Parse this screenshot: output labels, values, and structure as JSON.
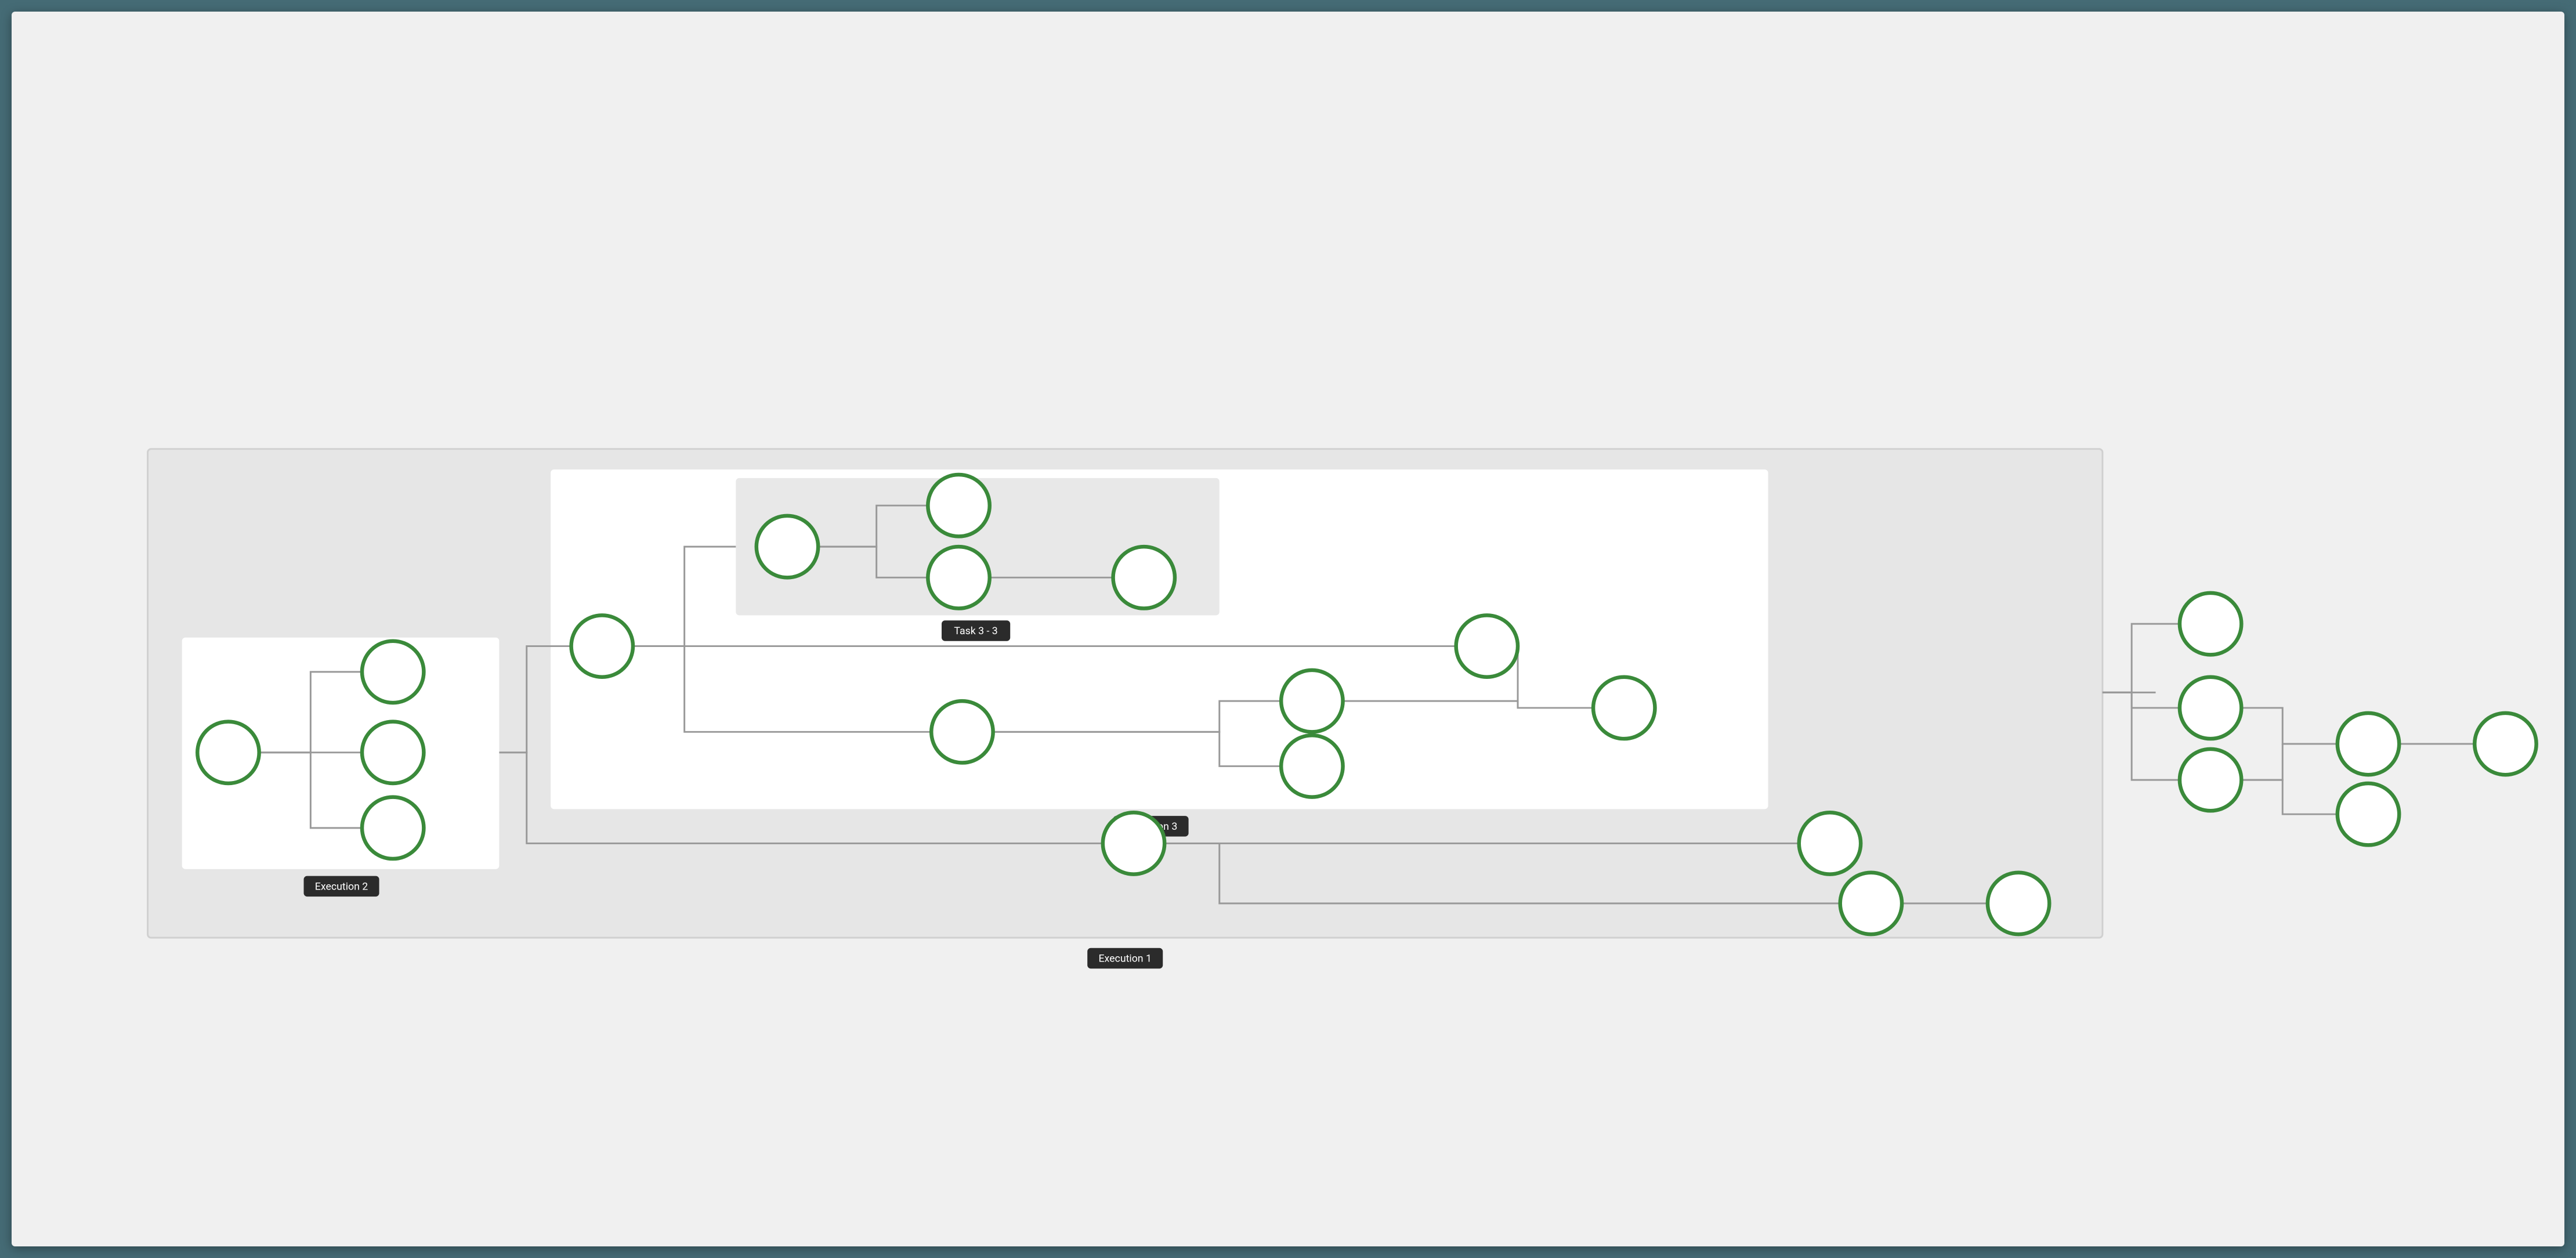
{
  "colors": {
    "page_bg": "#456b75",
    "stage_bg": "#f0f0f0",
    "group_bg": "#e6e6e6",
    "panel_white": "#ffffff",
    "panel_grey": "#e8e8e8",
    "edge": "#999999",
    "node_fill": "#ffffff",
    "node_stroke": "#3a8a3a",
    "label_bg": "#2b2b2b",
    "label_fg": "#ffffff"
  },
  "labels": {
    "execution1": "Execution 1",
    "execution2": "Execution 2",
    "execution3": "Execution 3",
    "task33": "Task 3 - 3"
  },
  "chart_data": {
    "type": "diagram",
    "description": "Nested execution/task workflow tree",
    "groups": [
      {
        "id": "execution1",
        "label_key": "execution1",
        "children_groups": [
          "execution2",
          "execution3"
        ]
      },
      {
        "id": "execution2",
        "label_key": "execution2",
        "parent": "execution1"
      },
      {
        "id": "execution3",
        "label_key": "execution3",
        "parent": "execution1",
        "children_groups": [
          "task33"
        ]
      },
      {
        "id": "task33",
        "label_key": "task33",
        "parent": "execution3"
      }
    ],
    "nodes": [
      {
        "id": "e2_root",
        "group": "execution2"
      },
      {
        "id": "e2_a",
        "group": "execution2"
      },
      {
        "id": "e2_b",
        "group": "execution2"
      },
      {
        "id": "e2_c",
        "group": "execution2"
      },
      {
        "id": "e3_root",
        "group": "execution3"
      },
      {
        "id": "t33_root",
        "group": "task33"
      },
      {
        "id": "t33_a",
        "group": "task33"
      },
      {
        "id": "t33_b",
        "group": "task33"
      },
      {
        "id": "t33_c",
        "group": "task33"
      },
      {
        "id": "e3_mid",
        "group": "execution3"
      },
      {
        "id": "e3_p1",
        "group": "execution3"
      },
      {
        "id": "e3_p2",
        "group": "execution3"
      },
      {
        "id": "e3_q",
        "group": "execution3"
      },
      {
        "id": "e3_out",
        "group": "execution3"
      },
      {
        "id": "e1_low_root",
        "group": "execution1"
      },
      {
        "id": "e1_low_a",
        "group": "execution1"
      },
      {
        "id": "e1_low_b",
        "group": "execution1"
      },
      {
        "id": "e1_low_c",
        "group": "execution1"
      },
      {
        "id": "out_root",
        "group": null
      },
      {
        "id": "out_a",
        "group": null
      },
      {
        "id": "out_b",
        "group": null
      },
      {
        "id": "out_c",
        "group": null
      },
      {
        "id": "out_d",
        "group": null
      },
      {
        "id": "out_e",
        "group": null
      }
    ],
    "edges": [
      [
        "e2_root",
        "e2_a"
      ],
      [
        "e2_root",
        "e2_b"
      ],
      [
        "e2_root",
        "e2_c"
      ],
      [
        "execution2_group",
        "e3_root"
      ],
      [
        "e3_root",
        "task33_group"
      ],
      [
        "e3_root",
        "e3_mid"
      ],
      [
        "e3_root",
        "e3_q"
      ],
      [
        "t33_root",
        "t33_a"
      ],
      [
        "t33_root",
        "t33_b"
      ],
      [
        "t33_b",
        "t33_c"
      ],
      [
        "e3_mid",
        "e3_p1"
      ],
      [
        "e3_mid",
        "e3_p2"
      ],
      [
        "e3_p1",
        "e3_out"
      ],
      [
        "e3_q",
        "e3_out"
      ],
      [
        "execution2_group",
        "e1_low_root"
      ],
      [
        "e1_low_root",
        "e1_low_a"
      ],
      [
        "e1_low_root",
        "e1_low_b"
      ],
      [
        "e1_low_b",
        "e1_low_c"
      ],
      [
        "execution1_group",
        "out_root"
      ],
      [
        "out_root",
        "out_a"
      ],
      [
        "out_root",
        "out_b"
      ],
      [
        "out_root",
        "out_c"
      ],
      [
        "out_b",
        "out_d"
      ],
      [
        "out_c",
        "out_d"
      ],
      [
        "out_d",
        "out_e"
      ]
    ]
  }
}
